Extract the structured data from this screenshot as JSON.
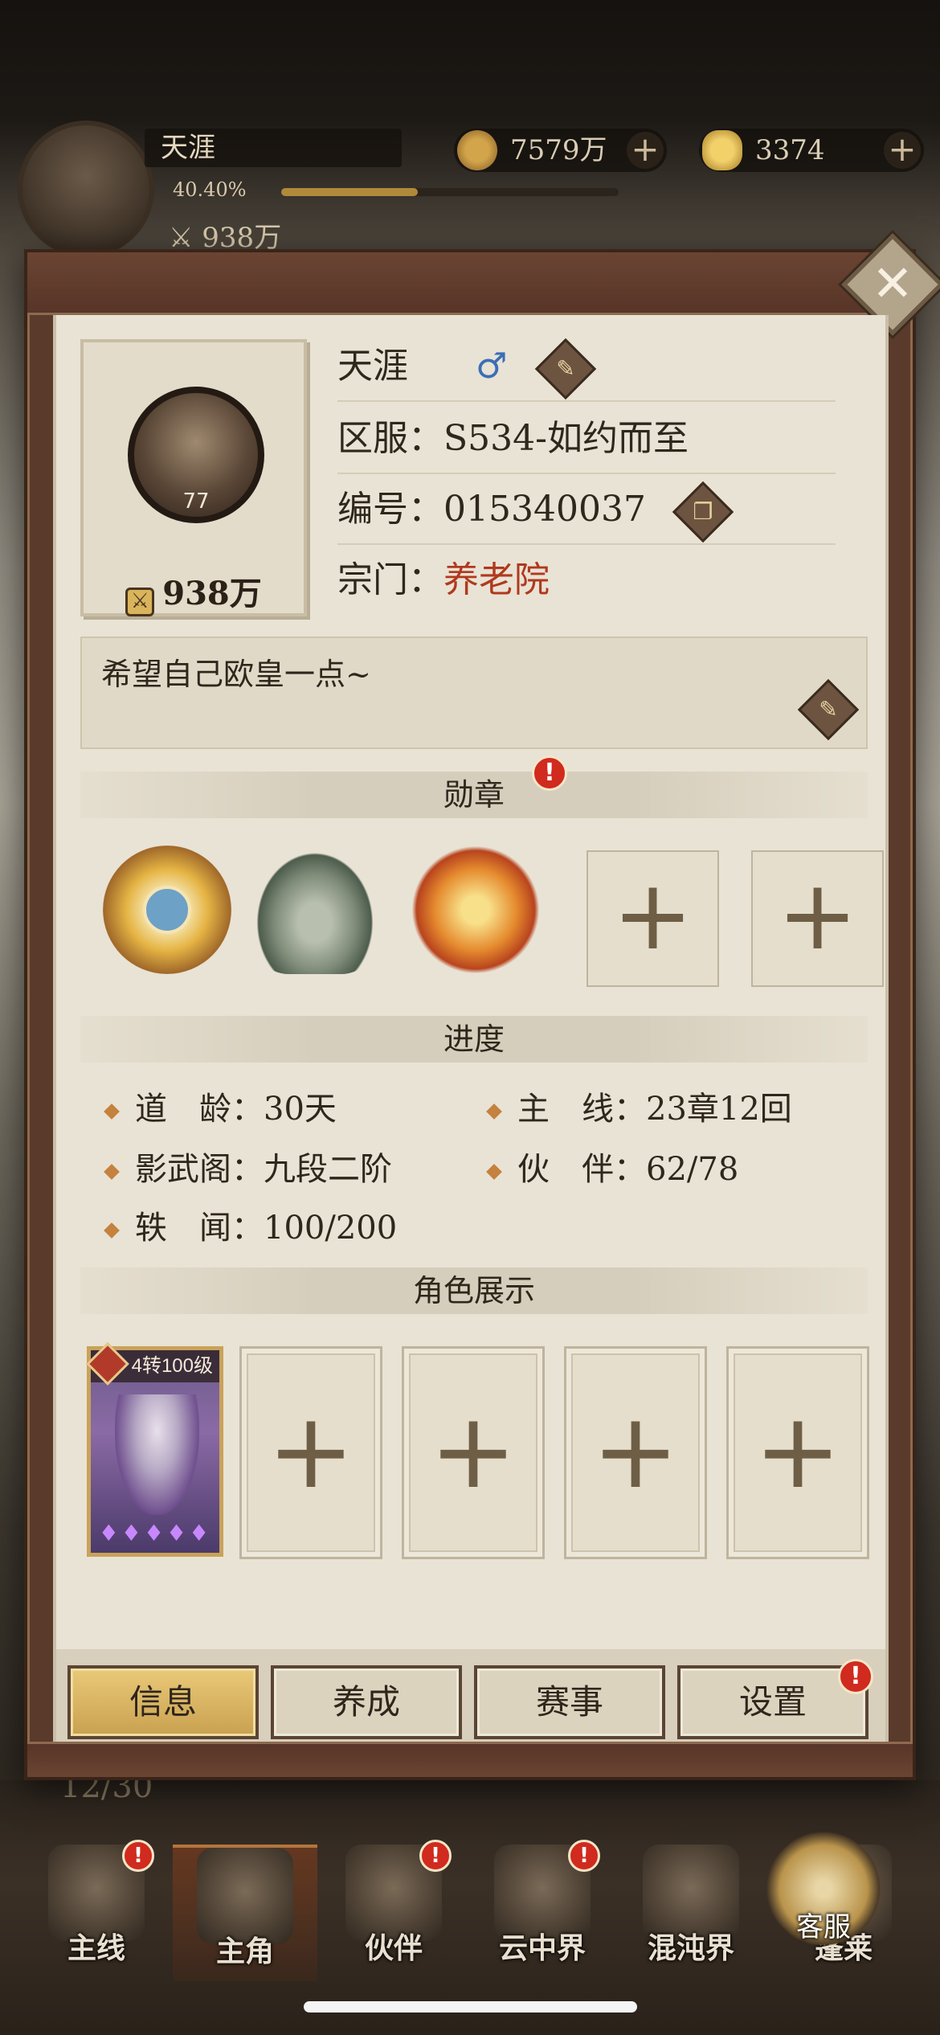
{
  "hud": {
    "player_name": "天涯",
    "exp_percent": "40.40%",
    "exp_fraction": 0.404,
    "power": "938万",
    "coins": "7579万",
    "gold": "3374",
    "plus": "+"
  },
  "profile": {
    "close": "✕",
    "name": "天涯",
    "gender_symbol": "♂",
    "server_label": "区服：",
    "server_value": "S534-如约而至",
    "id_label": "编号：",
    "id_value": "015340037",
    "sect_label": "宗门：",
    "sect_value": "养老院",
    "avatar_level": "77",
    "power": "938万",
    "motto": "希望自己欧皇一点~"
  },
  "sections": {
    "medals": "勋章",
    "progress": "进度",
    "roles": "角色展示",
    "alert": "!"
  },
  "medals": {
    "slot_plus": "+"
  },
  "progress": [
    {
      "label": "道　龄：",
      "value": "30天"
    },
    {
      "label": "主　线：",
      "value": "23章12回"
    },
    {
      "label": "影武阁：",
      "value": "九段二阶"
    },
    {
      "label": "伙　伴：",
      "value": "62/78"
    },
    {
      "label": "轶　闻：",
      "value": "100/200"
    }
  ],
  "roles": {
    "card_badge": "4转100级",
    "slot_plus": "+"
  },
  "tabs": [
    {
      "label": "信息",
      "active": true
    },
    {
      "label": "养成",
      "active": false
    },
    {
      "label": "赛事",
      "active": false
    },
    {
      "label": "设置",
      "active": false
    }
  ],
  "background": {
    "hidden_count": "12/30"
  },
  "nav": [
    {
      "label": "主线",
      "alert": true
    },
    {
      "label": "主角",
      "alert": false
    },
    {
      "label": "伙伴",
      "alert": true
    },
    {
      "label": "云中界",
      "alert": true
    },
    {
      "label": "混沌界",
      "alert": false
    },
    {
      "label": "蓬莱",
      "alert": false
    }
  ],
  "customer_service": "客服",
  "colors": {
    "accent_gold": "#c9a150",
    "alert_red": "#d12a1e",
    "sect_red": "#b0391e",
    "gender_blue": "#3a6fb6"
  }
}
